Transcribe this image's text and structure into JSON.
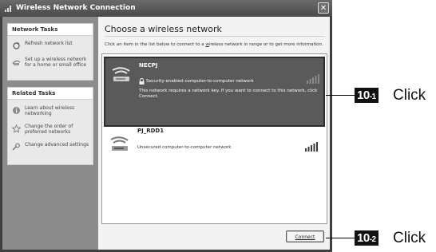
{
  "window": {
    "title": "Wireless Network Connection",
    "close_glyph": "✕"
  },
  "sidebar": {
    "network_tasks": {
      "header": "Network Tasks",
      "items": [
        {
          "label": "Refresh network list",
          "icon": "refresh-icon"
        },
        {
          "label": "Set up a wireless network for a home or small office",
          "icon": "setup-network-icon"
        }
      ]
    },
    "related_tasks": {
      "header": "Related Tasks",
      "items": [
        {
          "label": "Learn about wireless networking",
          "icon": "info-icon"
        },
        {
          "label": "Change the order of preferred networks",
          "icon": "star-icon"
        },
        {
          "label": "Change advanced settings",
          "icon": "settings-icon"
        }
      ]
    }
  },
  "main": {
    "heading": "Choose a wireless network",
    "instructions_before": "Click an item in the list below to connect to a ",
    "instructions_link": "w",
    "instructions_after": "ireless network in range or to get more information.",
    "networks": [
      {
        "name": "NECPJ",
        "status": "Security-enabled computer-to-computer network",
        "description": "This network requires a network key. If you want to connect to this network, click Connect.",
        "selected": true,
        "signal_bars": 5,
        "secured": true
      },
      {
        "name": "PJ_RDD1",
        "status": "Unsecured computer-to-computer network",
        "selected": false,
        "signal_bars": 5,
        "secured": false
      }
    ],
    "connect_label": "Connect"
  },
  "callouts": [
    {
      "num": "10",
      "sub": "-1",
      "text": "Click"
    },
    {
      "num": "10",
      "sub": "-2",
      "text": "Click"
    }
  ],
  "colors": {
    "selected_bg": "#5a5a5a",
    "sidebar_bg": "#8c8c8c",
    "titlebar_bg": "#5a5a5a"
  }
}
